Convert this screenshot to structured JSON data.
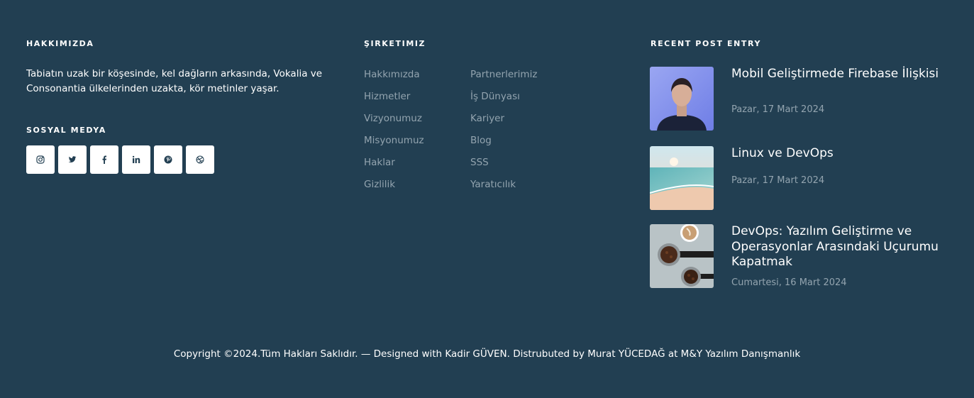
{
  "about": {
    "title": "HAKKIMIZDA",
    "text": "Tabiatın uzak bir köşesinde, kel dağların arkasında, Vokalia ve Consonantia ülkelerinden uzakta, kör metinler yaşar."
  },
  "social": {
    "title": "SOSYAL MEDYA",
    "icons": [
      "instagram-icon",
      "twitter-icon",
      "facebook-icon",
      "linkedin-icon",
      "pinterest-icon",
      "dribbble-icon"
    ],
    "icon_color": "#223f52"
  },
  "company": {
    "title": "ŞIRKETIMIZ",
    "links_left": [
      "Hakkımızda",
      "Hizmetler",
      "Vizyonumuz",
      "Misyonumuz",
      "Haklar",
      "Gizlilik"
    ],
    "links_right": [
      "Partnerlerimiz",
      "İş Dünyası",
      "Kariyer",
      "Blog",
      "SSS",
      "Yaratıcılık"
    ]
  },
  "posts": {
    "title": "RECENT POST ENTRY",
    "items": [
      {
        "title": "Mobil Geliştirmede Firebase İlişkisi",
        "date": "Pazar, 17 Mart 2024",
        "thumb": "portrait-image"
      },
      {
        "title": "Linux ve DevOps",
        "date": "Pazar, 17 Mart 2024",
        "thumb": "beach-image"
      },
      {
        "title": "DevOps: Yazılım Geliştirme ve Operasyonlar Arasındaki Uçurumu Kapatmak",
        "date": "Cumartesi, 16 Mart 2024",
        "thumb": "coffee-image"
      }
    ]
  },
  "footer": {
    "copyright": "Copyright ©2024.Tüm Hakları Saklıdır. — Designed with Kadir GÜVEN. Distrubuted by Murat YÜCEDAĞ at M&Y Yazılım Danışmanlık"
  },
  "colors": {
    "background": "#223f52",
    "muted_text": "#93a4af"
  }
}
